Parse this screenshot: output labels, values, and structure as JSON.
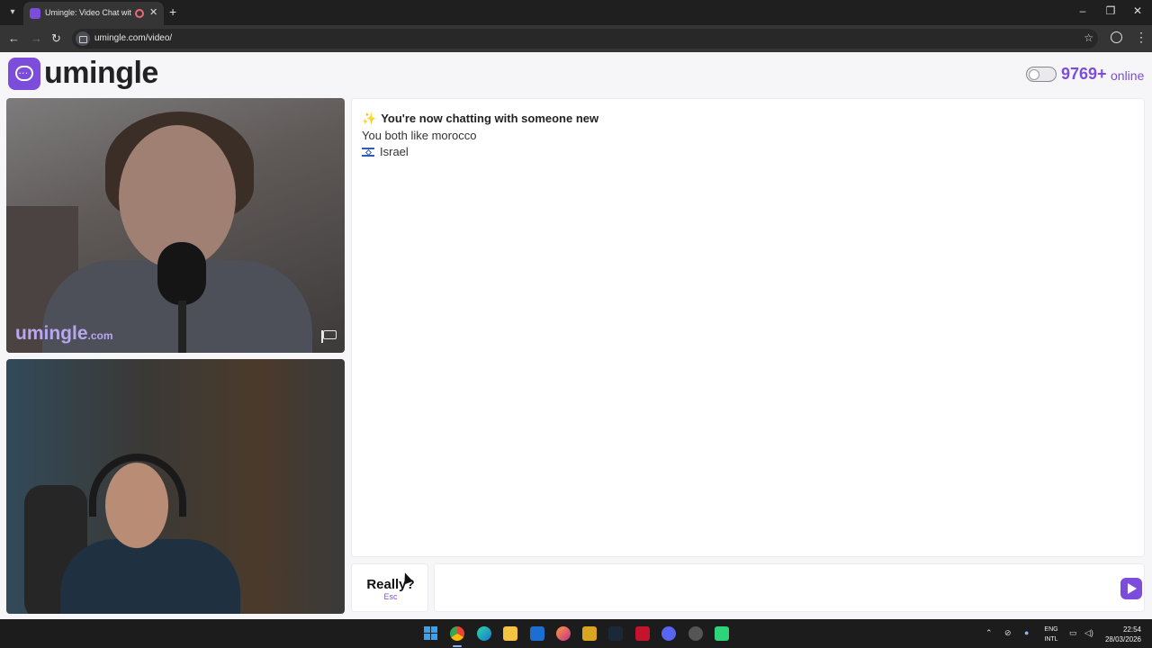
{
  "browser": {
    "tab_title": "Umingle: Video Chat with S",
    "url": "umingle.com/video/"
  },
  "header": {
    "logo_text": "umingle",
    "online_count": "9769+",
    "online_label": "online",
    "toggle_on": false
  },
  "video": {
    "watermark": "umingle",
    "watermark_suffix": ".com"
  },
  "chat": {
    "messages": [
      {
        "icon": "sparkles-icon",
        "text": "You're now chatting with someone new"
      },
      {
        "text": "You both like morocco"
      },
      {
        "icon": "israel-flag-icon",
        "text": "Israel"
      }
    ],
    "input_placeholder": ""
  },
  "skip_button": {
    "label": "Really?",
    "shortcut": "Esc"
  },
  "taskbar": {
    "lang_top": "ENG",
    "lang_bottom": "INTL",
    "time": "22:54",
    "date": "28/03/2026"
  },
  "colors": {
    "accent": "#7c4ddb",
    "watermark": "#b9a6f0"
  }
}
